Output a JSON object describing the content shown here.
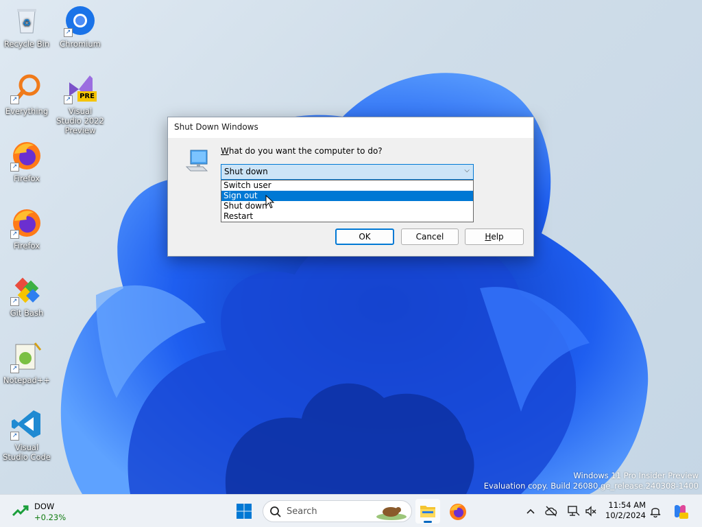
{
  "desktop": {
    "icons": [
      {
        "label": "Recycle Bin"
      },
      {
        "label": "Chromium"
      },
      {
        "label": "Everything"
      },
      {
        "label": "Visual Studio 2022 Preview"
      },
      {
        "label": "Firefox"
      },
      {
        "label": "Firefox"
      },
      {
        "label": "Git Bash"
      },
      {
        "label": "Notepad++"
      },
      {
        "label": "Visual Studio Code"
      }
    ],
    "vs_badge": "PRE"
  },
  "dialog": {
    "title": "Shut Down Windows",
    "question_underlined": "W",
    "question_rest": "hat do you want the computer to do?",
    "selected_value": "Shut down",
    "options": [
      "Switch user",
      "Sign out",
      "Shut down",
      "Restart"
    ],
    "highlighted_option": "Sign out",
    "ok_label": "OK",
    "cancel_label": "Cancel",
    "help_underlined": "H",
    "help_rest": "elp"
  },
  "watermark": {
    "line1": "Windows 11 Pro Insider Preview",
    "line2": "Evaluation copy. Build 26080.ge_release.240308-1400"
  },
  "taskbar": {
    "widget_title": "DOW",
    "widget_value": "+0.23%",
    "search_placeholder": "Search",
    "time": "11:54 AM",
    "date": "10/2/2024"
  },
  "colors": {
    "accent": "#0078d4",
    "wallpaper_blue": "#1a5de0",
    "positive": "#0f7b0f"
  }
}
